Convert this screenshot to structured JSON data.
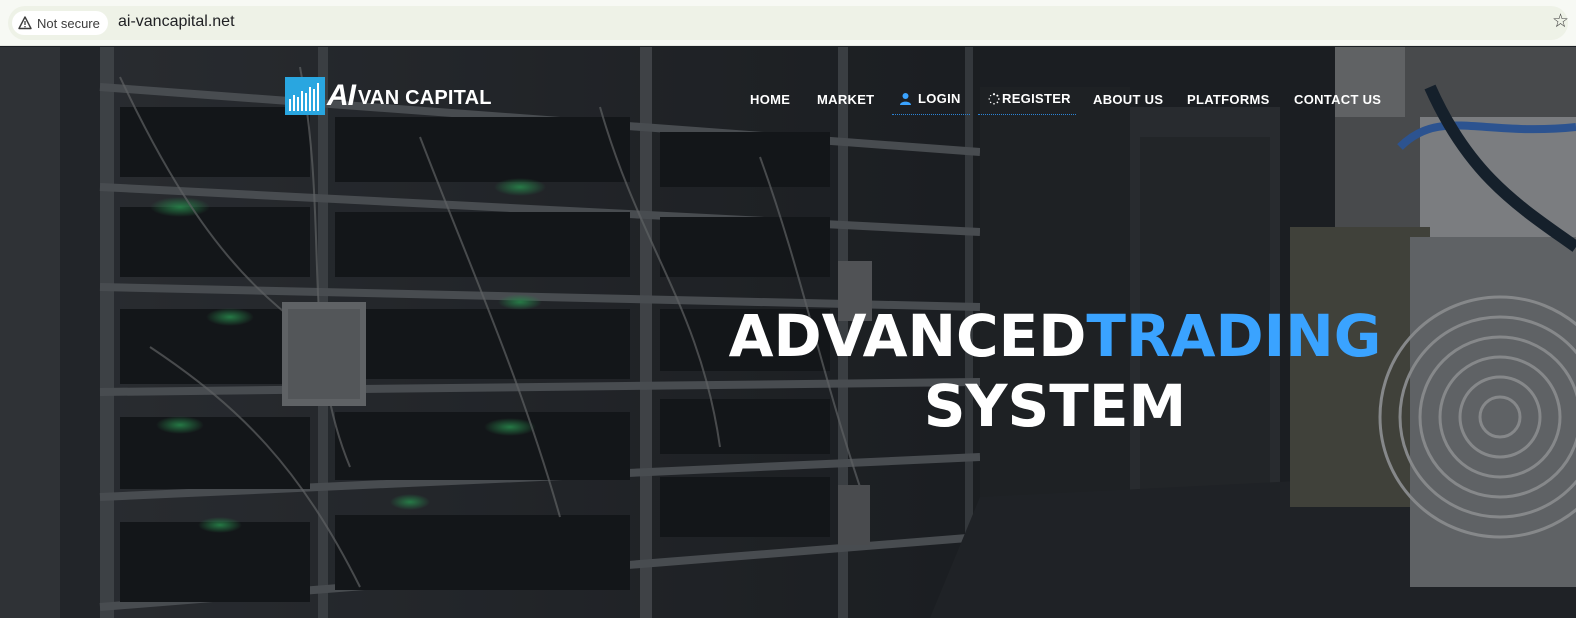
{
  "browser": {
    "security_label": "Not secure",
    "url": "ai-vancapital.net",
    "icons": {
      "warning": "warning-triangle-icon",
      "bookmark": "star-icon"
    }
  },
  "site": {
    "logo": {
      "mark": "AI",
      "name": "VAN CAPITAL"
    },
    "nav": [
      {
        "label": "HOME"
      },
      {
        "label": "MARKET"
      },
      {
        "label": "LOGIN",
        "icon": "user-icon"
      },
      {
        "label": "REGISTER",
        "icon": "spinner-icon"
      },
      {
        "label": "ABOUT US"
      },
      {
        "label": "PLATFORMS"
      },
      {
        "label": "CONTACT US"
      }
    ],
    "hero": {
      "headline_part1": "ADVANCED",
      "headline_accent": "TRADING",
      "headline_line2": "SYSTEM"
    }
  },
  "colors": {
    "accent": "#3aa3ff",
    "logo_blue": "#29a6e0",
    "nav_text": "#ffffff",
    "underline": "#2b83d6"
  }
}
